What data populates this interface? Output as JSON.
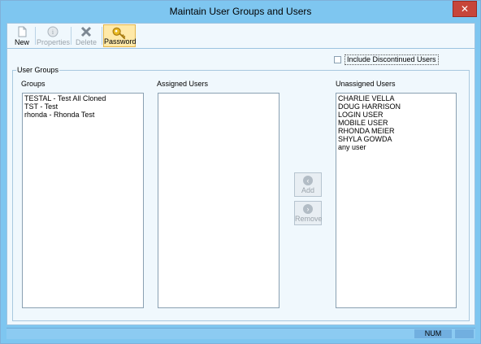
{
  "window": {
    "title": "Maintain User Groups and Users",
    "close_glyph": "✕"
  },
  "toolbar": {
    "new_label": "New",
    "properties_label": "Properties",
    "delete_label": "Delete",
    "password_label": "Password",
    "icons": [
      "document-icon",
      "properties-icon",
      "delete-x-icon",
      "key-icon"
    ]
  },
  "options": {
    "include_discontinued_label": "Include Discontinued Users",
    "include_discontinued_checked": false
  },
  "groupbox": {
    "title": "User Groups"
  },
  "groups": {
    "label": "Groups",
    "items": [
      "TESTAL - Test All Cloned",
      "TST - Test",
      "rhonda - Rhonda Test"
    ]
  },
  "assigned": {
    "label": "Assigned Users",
    "items": []
  },
  "unassigned": {
    "label": "Unassigned Users",
    "items": [
      "CHARLIE VELLA",
      "DOUG HARRISON",
      "LOGIN USER",
      "MOBILE USER",
      "RHONDA MEIER",
      "SHYLA GOWDA",
      "any user"
    ]
  },
  "actions": {
    "add_label": "Add",
    "remove_label": "Remove"
  },
  "statusbar": {
    "num_label": "NUM"
  },
  "colors": {
    "titlebar": "#7ec6f0",
    "close": "#c7463a",
    "client": "#f0f8fd",
    "status": "#8ccbf2"
  }
}
